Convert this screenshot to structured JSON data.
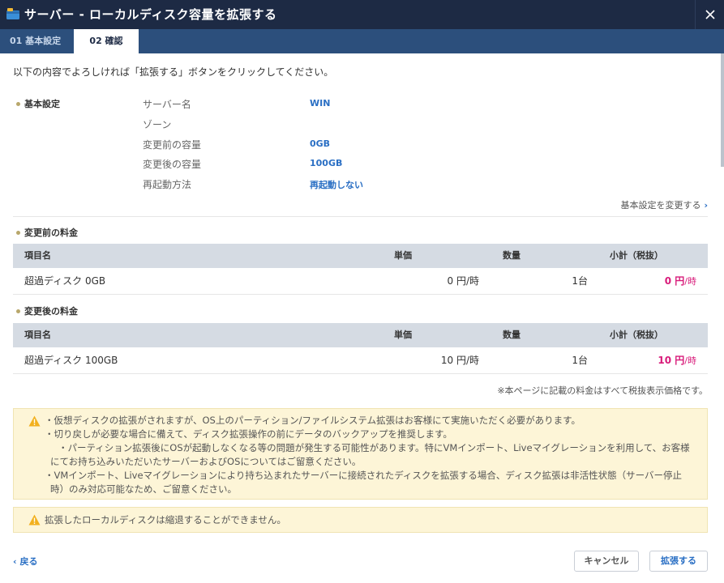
{
  "window": {
    "title": "サーバー - ローカルディスク容量を拡張する",
    "close_icon": "close-icon",
    "app_icon": "disk-folder-icon"
  },
  "tabs": [
    {
      "label": "01 基本設定",
      "active": false
    },
    {
      "label": "02 確認",
      "active": true
    }
  ],
  "intro": "以下の内容でよろしければ「拡張する」ボタンをクリックしてください。",
  "basic": {
    "heading": "基本設定",
    "rows": [
      {
        "label": "サーバー名",
        "value": "WIN"
      },
      {
        "label": "ゾーン",
        "value": ""
      },
      {
        "label": "変更前の容量",
        "value": "0GB"
      },
      {
        "label": "変更後の容量",
        "value": "100GB"
      },
      {
        "label": "再起動方法",
        "value": "再起動しない"
      }
    ],
    "change_link": "基本設定を変更する"
  },
  "table_headers": {
    "item": "項目名",
    "unit": "単価",
    "qty": "数量",
    "subtotal": "小計（税抜）"
  },
  "before": {
    "heading": "変更前の料金",
    "item": "超過ディスク 0GB",
    "unit": "0 円/時",
    "qty": "1台",
    "amount": "0 円",
    "per": "/時"
  },
  "after": {
    "heading": "変更後の料金",
    "item": "超過ディスク 100GB",
    "unit": "10 円/時",
    "qty": "1台",
    "amount": "10 円",
    "per": "/時"
  },
  "tax_note": "※本ページに記載の料金はすべて税抜表示価格です。",
  "warnings": {
    "line1": "・仮想ディスクの拡張がされますが、OS上のパーティション/ファイルシステム拡張はお客様にて実施いただく必要があります。",
    "line2": "・切り戻しが必要な場合に備えて、ディスク拡張操作の前にデータのバックアップを推奨します。",
    "line3": "・パーティション拡張後にOSが起動しなくなる等の問題が発生する可能性があります。特にVMインポート、Liveマイグレーションを利用して、お客様",
    "line4": "にてお持ち込みいただいたサーバーおよびOSについてはご留意ください。",
    "line5": "・VMインポート、Liveマイグレーションにより持ち込まれたサーバーに接続されたディスクを拡張する場合、ディスク拡張は非活性状態（サーバー停止",
    "line6": "時）のみ対応可能なため、ご留意ください。"
  },
  "notice": "拡張したローカルディスクは縮退することができません。",
  "footer": {
    "back": "戻る",
    "cancel": "キャンセル",
    "extend": "拡張する"
  },
  "colors": {
    "titlebar": "#1d2a44",
    "tabbar": "#2c4f7c",
    "accent_blue": "#2a6fc4",
    "price_pink": "#d81b7a",
    "warning_bg": "#fdf5d7"
  }
}
